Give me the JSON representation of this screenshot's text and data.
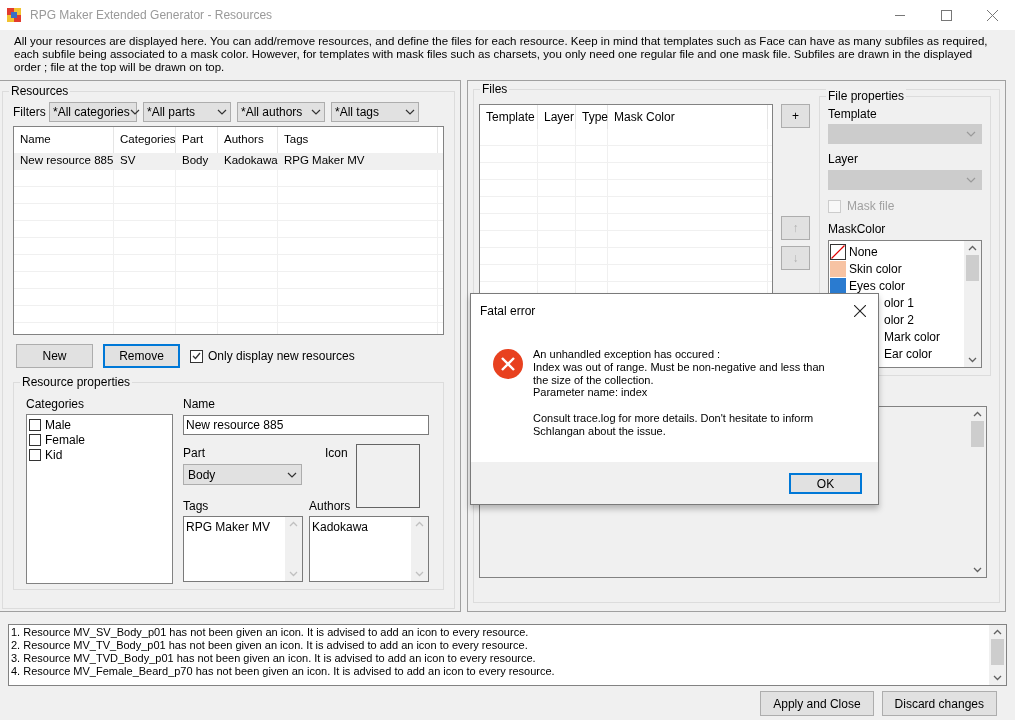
{
  "window": {
    "title": "RPG Maker Extended Generator - Resources"
  },
  "description": "All your resources are displayed here. You can add/remove resources, and define the files for each resource. Keep in mind that templates such as Face can have as many subfiles as required, each subfile being associated to a mask color. However, for templates with mask files such as charsets, you only need one regular file and one mask file. Subfiles are drawn in the displayed order ; file at the top will be drawn on top.",
  "resources": {
    "title": "Resources",
    "filters_label": "Filters",
    "filters": [
      "*All categories",
      "*All parts",
      "*All authors",
      "*All tags"
    ],
    "columns": [
      "Name",
      "Categories",
      "Part",
      "Authors",
      "Tags"
    ],
    "rows": [
      {
        "cells": [
          "New resource 885",
          "SV",
          "Body",
          "Kadokawa",
          "RPG Maker MV"
        ],
        "selected": true
      }
    ],
    "buttons": [
      {
        "label": "New",
        "focused": false
      },
      {
        "label": "Remove",
        "focused": true
      }
    ],
    "only_new": {
      "label": "Only display new resources",
      "checked": true
    }
  },
  "resource_properties": {
    "title": "Resource properties",
    "categories_label": "Categories",
    "categories": [
      {
        "label": "Male",
        "checked": false
      },
      {
        "label": "Female",
        "checked": false
      },
      {
        "label": "Kid",
        "checked": false
      }
    ],
    "name_label": "Name",
    "name_value": "New resource 885",
    "part_label": "Part",
    "part_value": "Body",
    "icon_label": "Icon",
    "tags_label": "Tags",
    "tags": [
      "RPG Maker MV"
    ],
    "authors_label": "Authors",
    "authors": [
      "Kadokawa"
    ]
  },
  "files": {
    "title": "Files",
    "columns": [
      "Template",
      "Layer",
      "Type",
      "Mask Color"
    ],
    "buttons": [
      {
        "label": "+",
        "disabled": false
      },
      {
        "label": "↑",
        "disabled": true
      },
      {
        "label": "↓",
        "disabled": true
      }
    ]
  },
  "file_properties": {
    "title": "File properties",
    "template_label": "Template",
    "layer_label": "Layer",
    "mask_file": {
      "label": "Mask file",
      "checked": false,
      "disabled": true
    },
    "mask_color_label": "MaskColor",
    "mask_colors": [
      {
        "kind": "none",
        "label": "None"
      },
      {
        "kind": "swatch",
        "label": "Skin color",
        "color": "#f7c3a3"
      },
      {
        "kind": "swatch",
        "label": "Eyes color",
        "color": "#2a7bd0"
      },
      {
        "kind": "covered",
        "label": "olor 1"
      },
      {
        "kind": "covered",
        "label": "olor 2"
      },
      {
        "kind": "covered",
        "label": "Mark color"
      },
      {
        "kind": "covered",
        "label": "Ear color"
      }
    ]
  },
  "log": [
    "1. Resource MV_SV_Body_p01 has not been given an icon. It is advised to add an icon to every resource.",
    "2. Resource MV_TV_Body_p01 has not been given an icon. It is advised to add an icon to every resource.",
    "3. Resource MV_TVD_Body_p01 has not been given an icon. It is advised to add an icon to every resource.",
    "4. Resource MV_Female_Beard_p70 has not been given an icon. It is advised to add an icon to every resource."
  ],
  "footer_buttons": [
    "Apply and Close",
    "Discard changes"
  ],
  "dialog": {
    "title": "Fatal error",
    "message": [
      "An unhandled exception has occured :",
      "Index was out of range. Must be non-negative and less than",
      "the size of the collection.",
      "Parameter name: index"
    ],
    "details": [
      "Consult trace.log for more details. Don't hesitate to inform",
      "Schlangan about the issue."
    ],
    "button": "OK"
  }
}
